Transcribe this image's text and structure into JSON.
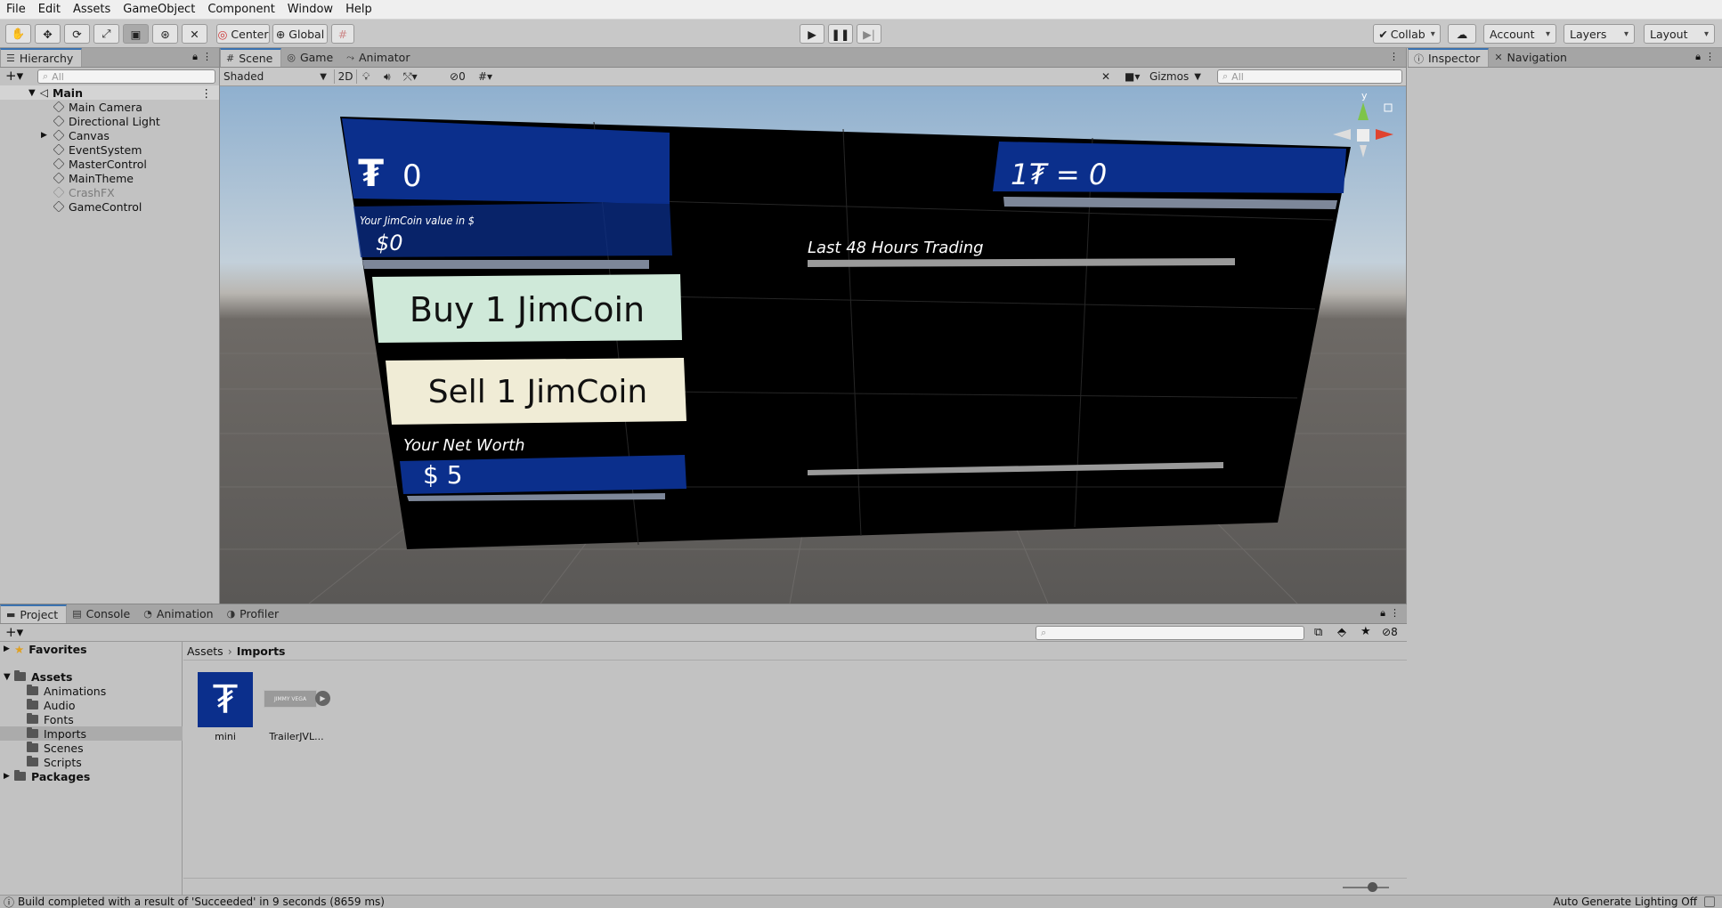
{
  "menu": [
    "File",
    "Edit",
    "Assets",
    "GameObject",
    "Component",
    "Window",
    "Help"
  ],
  "toolbar": {
    "pivot_label": "Center",
    "space_label": "Global",
    "collab_label": "Collab",
    "account_label": "Account",
    "layers_label": "Layers",
    "layout_label": "Layout"
  },
  "hierarchy": {
    "tab": "Hierarchy",
    "search_placeholder": "All",
    "scene_name": "Main",
    "items": [
      "Main Camera",
      "Directional Light",
      "Canvas",
      "EventSystem",
      "MasterControl",
      "MainTheme",
      "CrashFX",
      "GameControl"
    ]
  },
  "scene_view": {
    "tabs": [
      "Scene",
      "Game",
      "Animator"
    ],
    "shading_mode": "Shaded",
    "mode_2d": "2D",
    "hidden_count": "0",
    "gizmos_label": "Gizmos",
    "search_placeholder": "All",
    "axis_y": "y"
  },
  "game_ui": {
    "coin_balance": "0",
    "coin_value_label": "Your JimCoin value in $",
    "coin_value": "$0",
    "rate": "1₮ = 0",
    "trading_label": "Last 48 Hours Trading",
    "buy_button": "Buy 1 JimCoin",
    "sell_button": "Sell 1 JimCoin",
    "net_worth_label": "Your Net Worth",
    "net_worth_value": "$ 5",
    "coin_symbol": "₮"
  },
  "inspector": {
    "tabs": [
      "Inspector",
      "Navigation"
    ]
  },
  "project": {
    "tabs": [
      "Project",
      "Console",
      "Animation",
      "Profiler"
    ],
    "search_placeholder": "",
    "hidden_count": "8",
    "tree_favorites": "Favorites",
    "tree_assets": "Assets",
    "folders": [
      "Animations",
      "Audio",
      "Fonts",
      "Imports",
      "Scenes",
      "Scripts"
    ],
    "tree_packages": "Packages",
    "breadcrumb_root": "Assets",
    "breadcrumb_current": "Imports",
    "assets": [
      {
        "name": "mini"
      },
      {
        "name": "TrailerJVL...",
        "thumb_text": "JIMMY VEGA"
      }
    ]
  },
  "status": {
    "message": "Build completed with a result of 'Succeeded' in 9 seconds (8659 ms)",
    "lighting": "Auto Generate Lighting Off"
  },
  "colors": {
    "accent": "#3a72b0",
    "panel_blue": "#0b2f8c",
    "buy_bg": "#cfe9d9",
    "sell_bg": "#f0ecd6"
  }
}
